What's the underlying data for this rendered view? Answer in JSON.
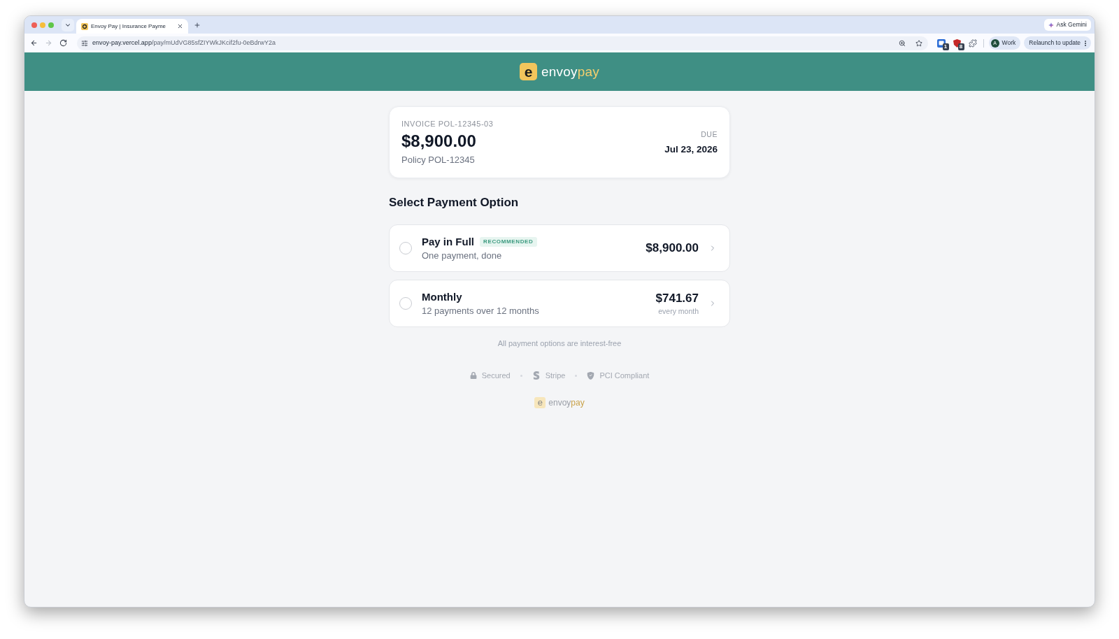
{
  "browser": {
    "tabs": [
      {
        "title": "Envoy Pay | Insurance Payme",
        "selected": true
      }
    ],
    "ask_gemini": "Ask Gemini",
    "nav_buttons": [
      {
        "kind": "back",
        "disabled": false
      },
      {
        "kind": "forward",
        "disabled": true
      },
      {
        "kind": "reload",
        "disabled": false
      }
    ],
    "url": {
      "host": "envoy-pay.vercel.app",
      "path": "/pay/mUdVG85sfZIYWkJKcif2fu-0eBdrwY2a"
    },
    "extensions": [
      {
        "kind": "window",
        "badge": "1"
      },
      {
        "kind": "shield",
        "badge": "8"
      },
      {
        "kind": "puzzle"
      }
    ],
    "profile": {
      "initial": "A",
      "label": "Work"
    },
    "relaunch": "Relaunch to update"
  },
  "header": {
    "logo": {
      "mark": "e",
      "word": "envoy",
      "accent": "pay"
    }
  },
  "invoice": {
    "label": "INVOICE POL-12345-03",
    "amount": "$8,900.00",
    "policy": "Policy POL-12345",
    "due_label": "DUE",
    "due_date": "Jul 23, 2026"
  },
  "payment_section": {
    "title": "Select Payment Option",
    "options": [
      {
        "title": "Pay in Full",
        "badge": "RECOMMENDED",
        "subtitle": "One payment, done",
        "amount": "$8,900.00",
        "selected": false
      },
      {
        "title": "Monthly",
        "subtitle": "12 payments over 12 months",
        "amount": "$741.67",
        "amount_note": "every month",
        "selected": false
      }
    ],
    "note": "All payment options are interest-free"
  },
  "trust_badges": [
    {
      "kind": "lock",
      "label": "Secured"
    },
    {
      "kind": "stripe",
      "label": "Stripe"
    },
    {
      "kind": "shield",
      "label": "PCI Compliant"
    }
  ],
  "footer": {
    "logo": {
      "mark": "e",
      "word": "envoy",
      "accent": "pay"
    }
  }
}
